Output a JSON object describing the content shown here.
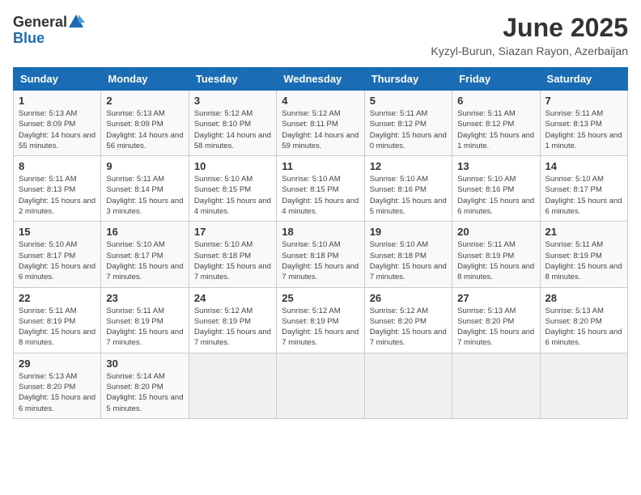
{
  "logo": {
    "general": "General",
    "blue": "Blue"
  },
  "title": {
    "month": "June 2025",
    "location": "Kyzyl-Burun, Siazan Rayon, Azerbaijan"
  },
  "headers": [
    "Sunday",
    "Monday",
    "Tuesday",
    "Wednesday",
    "Thursday",
    "Friday",
    "Saturday"
  ],
  "weeks": [
    [
      {
        "day": "1",
        "sunrise": "5:13 AM",
        "sunset": "8:09 PM",
        "daylight": "14 hours and 55 minutes."
      },
      {
        "day": "2",
        "sunrise": "5:13 AM",
        "sunset": "8:09 PM",
        "daylight": "14 hours and 56 minutes."
      },
      {
        "day": "3",
        "sunrise": "5:12 AM",
        "sunset": "8:10 PM",
        "daylight": "14 hours and 58 minutes."
      },
      {
        "day": "4",
        "sunrise": "5:12 AM",
        "sunset": "8:11 PM",
        "daylight": "14 hours and 59 minutes."
      },
      {
        "day": "5",
        "sunrise": "5:11 AM",
        "sunset": "8:12 PM",
        "daylight": "15 hours and 0 minutes."
      },
      {
        "day": "6",
        "sunrise": "5:11 AM",
        "sunset": "8:12 PM",
        "daylight": "15 hours and 1 minute."
      },
      {
        "day": "7",
        "sunrise": "5:11 AM",
        "sunset": "8:13 PM",
        "daylight": "15 hours and 1 minute."
      }
    ],
    [
      {
        "day": "8",
        "sunrise": "5:11 AM",
        "sunset": "8:13 PM",
        "daylight": "15 hours and 2 minutes."
      },
      {
        "day": "9",
        "sunrise": "5:11 AM",
        "sunset": "8:14 PM",
        "daylight": "15 hours and 3 minutes."
      },
      {
        "day": "10",
        "sunrise": "5:10 AM",
        "sunset": "8:15 PM",
        "daylight": "15 hours and 4 minutes."
      },
      {
        "day": "11",
        "sunrise": "5:10 AM",
        "sunset": "8:15 PM",
        "daylight": "15 hours and 4 minutes."
      },
      {
        "day": "12",
        "sunrise": "5:10 AM",
        "sunset": "8:16 PM",
        "daylight": "15 hours and 5 minutes."
      },
      {
        "day": "13",
        "sunrise": "5:10 AM",
        "sunset": "8:16 PM",
        "daylight": "15 hours and 6 minutes."
      },
      {
        "day": "14",
        "sunrise": "5:10 AM",
        "sunset": "8:17 PM",
        "daylight": "15 hours and 6 minutes."
      }
    ],
    [
      {
        "day": "15",
        "sunrise": "5:10 AM",
        "sunset": "8:17 PM",
        "daylight": "15 hours and 6 minutes."
      },
      {
        "day": "16",
        "sunrise": "5:10 AM",
        "sunset": "8:17 PM",
        "daylight": "15 hours and 7 minutes."
      },
      {
        "day": "17",
        "sunrise": "5:10 AM",
        "sunset": "8:18 PM",
        "daylight": "15 hours and 7 minutes."
      },
      {
        "day": "18",
        "sunrise": "5:10 AM",
        "sunset": "8:18 PM",
        "daylight": "15 hours and 7 minutes."
      },
      {
        "day": "19",
        "sunrise": "5:10 AM",
        "sunset": "8:18 PM",
        "daylight": "15 hours and 7 minutes."
      },
      {
        "day": "20",
        "sunrise": "5:11 AM",
        "sunset": "8:19 PM",
        "daylight": "15 hours and 8 minutes."
      },
      {
        "day": "21",
        "sunrise": "5:11 AM",
        "sunset": "8:19 PM",
        "daylight": "15 hours and 8 minutes."
      }
    ],
    [
      {
        "day": "22",
        "sunrise": "5:11 AM",
        "sunset": "8:19 PM",
        "daylight": "15 hours and 8 minutes."
      },
      {
        "day": "23",
        "sunrise": "5:11 AM",
        "sunset": "8:19 PM",
        "daylight": "15 hours and 7 minutes."
      },
      {
        "day": "24",
        "sunrise": "5:12 AM",
        "sunset": "8:19 PM",
        "daylight": "15 hours and 7 minutes."
      },
      {
        "day": "25",
        "sunrise": "5:12 AM",
        "sunset": "8:19 PM",
        "daylight": "15 hours and 7 minutes."
      },
      {
        "day": "26",
        "sunrise": "5:12 AM",
        "sunset": "8:20 PM",
        "daylight": "15 hours and 7 minutes."
      },
      {
        "day": "27",
        "sunrise": "5:13 AM",
        "sunset": "8:20 PM",
        "daylight": "15 hours and 7 minutes."
      },
      {
        "day": "28",
        "sunrise": "5:13 AM",
        "sunset": "8:20 PM",
        "daylight": "15 hours and 6 minutes."
      }
    ],
    [
      {
        "day": "29",
        "sunrise": "5:13 AM",
        "sunset": "8:20 PM",
        "daylight": "15 hours and 6 minutes."
      },
      {
        "day": "30",
        "sunrise": "5:14 AM",
        "sunset": "8:20 PM",
        "daylight": "15 hours and 5 minutes."
      },
      null,
      null,
      null,
      null,
      null
    ]
  ]
}
